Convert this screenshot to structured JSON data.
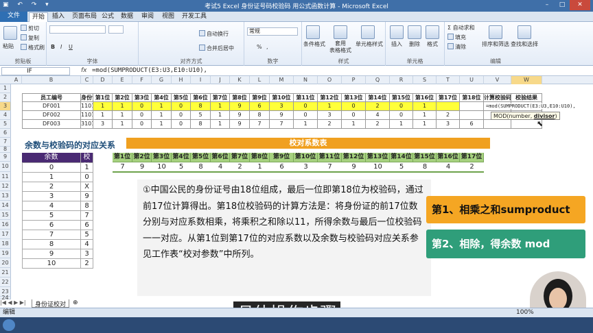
{
  "window": {
    "title": "考试5 Excel 身份证号码校验码  用公式函数计算 - Microsoft Excel",
    "controls": [
      "–",
      "□",
      "✕"
    ]
  },
  "tabs": [
    "文件",
    "开始",
    "插入",
    "页面布局",
    "公式",
    "数据",
    "审阅",
    "视图",
    "开发工具"
  ],
  "ribbon": {
    "clipboard": {
      "paste": "粘贴",
      "cut": "剪切",
      "copy": "复制",
      "format_painter": "格式刷",
      "label": "剪贴板"
    },
    "font": {
      "label": "字体",
      "b": "B",
      "i": "I",
      "u": "U"
    },
    "align": {
      "wrap": "自动换行",
      "merge": "合并后居中",
      "label": "对齐方式"
    },
    "number": {
      "format": "常规",
      "pct": "%",
      "comma": ",",
      "label": "数字"
    },
    "styles": {
      "cond": "条件格式",
      "table": "套用\n表格格式",
      "cell": "单元格样式",
      "label": "样式"
    },
    "cells": {
      "insert": "插入",
      "delete": "删除",
      "format": "格式",
      "label": "单元格"
    },
    "editing": {
      "autosum": "自动求和",
      "fill": "填充",
      "clear": "清除",
      "sort": "排序和筛选",
      "find": "查找和选择",
      "label": "编辑"
    }
  },
  "formula_bar": {
    "name_box": "IF",
    "fx": "fx",
    "formula": "=mod(SUMPRODUCT(E3:U3,E10:U10),"
  },
  "columns": [
    "A",
    "B",
    "C",
    "D",
    "E",
    "F",
    "G",
    "H",
    "I",
    "J",
    "K",
    "L",
    "M",
    "N",
    "O",
    "P",
    "Q",
    "R",
    "S",
    "T",
    "U",
    "V",
    "W",
    "X"
  ],
  "rows": [
    "1",
    "2",
    "3",
    "4",
    "5",
    "6",
    "7",
    "8",
    "9",
    "10",
    "11",
    "12",
    "13",
    "14",
    "15",
    "16",
    "17",
    "18",
    "19",
    "20",
    "21",
    "22",
    "23",
    "24"
  ],
  "main_table": {
    "headers": [
      "员工编号",
      "身份证号",
      "第1位",
      "第2位",
      "第3位",
      "第4位",
      "第5位",
      "第6位",
      "第7位",
      "第8位",
      "第9位",
      "第10位",
      "第11位",
      "第12位",
      "第13位",
      "第14位",
      "第15位",
      "第16位",
      "第17位",
      "第18位",
      "计算校验码",
      "校验结果"
    ],
    "rows": [
      [
        "DF001",
        "11010819630102011X",
        "1",
        "1",
        "0",
        "1",
        "0",
        "8",
        "1",
        "9",
        "6",
        "3",
        "0",
        "1",
        "0",
        "2",
        "0",
        "1",
        "",
        "",
        "",
        ""
      ],
      [
        "DF002",
        "110108198903040126",
        "1",
        "1",
        "0",
        "1",
        "0",
        "5",
        "1",
        "9",
        "8",
        "9",
        "0",
        "3",
        "0",
        "4",
        "0",
        "1",
        "2",
        "",
        "",
        ""
      ],
      [
        "DF003",
        "310108197712121136",
        "3",
        "1",
        "0",
        "1",
        "0",
        "8",
        "1",
        "9",
        "7",
        "7",
        "1",
        "2",
        "1",
        "2",
        "1",
        "1",
        "3",
        "6",
        "",
        ""
      ]
    ]
  },
  "cell_edit": {
    "text": "=mod(SUMPRODUCT(E3:U3,E10:U10),",
    "tooltip_fn": "MOD(number, ",
    "tooltip_arg": "divisor",
    "tooltip_end": ")"
  },
  "left_table": {
    "title": "余数与校验码的对应关系",
    "headers": [
      "余数",
      "校验码"
    ],
    "rows": [
      [
        "0",
        "1"
      ],
      [
        "1",
        "0"
      ],
      [
        "2",
        "X"
      ],
      [
        "3",
        "9"
      ],
      [
        "4",
        "8"
      ],
      [
        "5",
        "7"
      ],
      [
        "6",
        "6"
      ],
      [
        "7",
        "5"
      ],
      [
        "8",
        "4"
      ],
      [
        "9",
        "3"
      ],
      [
        "10",
        "2"
      ]
    ]
  },
  "coef_table": {
    "title": "校对系数表",
    "headers": [
      "第1位",
      "第2位",
      "第3位",
      "第4位",
      "第5位",
      "第6位",
      "第7位",
      "第8位",
      "第9位",
      "第10位",
      "第11位",
      "第12位",
      "第13位",
      "第14位",
      "第15位",
      "第16位",
      "第17位"
    ],
    "values": [
      "7",
      "9",
      "10",
      "5",
      "8",
      "4",
      "2",
      "1",
      "6",
      "3",
      "7",
      "9",
      "10",
      "5",
      "8",
      "4",
      "2"
    ]
  },
  "note": {
    "text": "①中国公民的身份证号由18位组成，最后一位即第18位为校验码，通过前17位计算得出。第18位校验码的计算方法是：将身份证的前17位数分别与对应系数相乘，将乘积之和除以11，所得余数与最后一位校验码一一对应。从第1位到第17位的对应系数以及余数与校验码对应关系参见工作表“校对参数”中所列。"
  },
  "callouts": {
    "step1": "第1、相乘之和sumproduct",
    "step2": "第2、相除，得余数 mod"
  },
  "subtitle": "具体操作步骤",
  "sheet_tab": "身份证校对",
  "status": {
    "mode": "编辑",
    "zoom": "100%"
  },
  "colors": {
    "yellow": "#ffff3a",
    "orange": "#f0a020",
    "green_callout": "#2f9e7a",
    "title_blue": "#1f4e79"
  }
}
